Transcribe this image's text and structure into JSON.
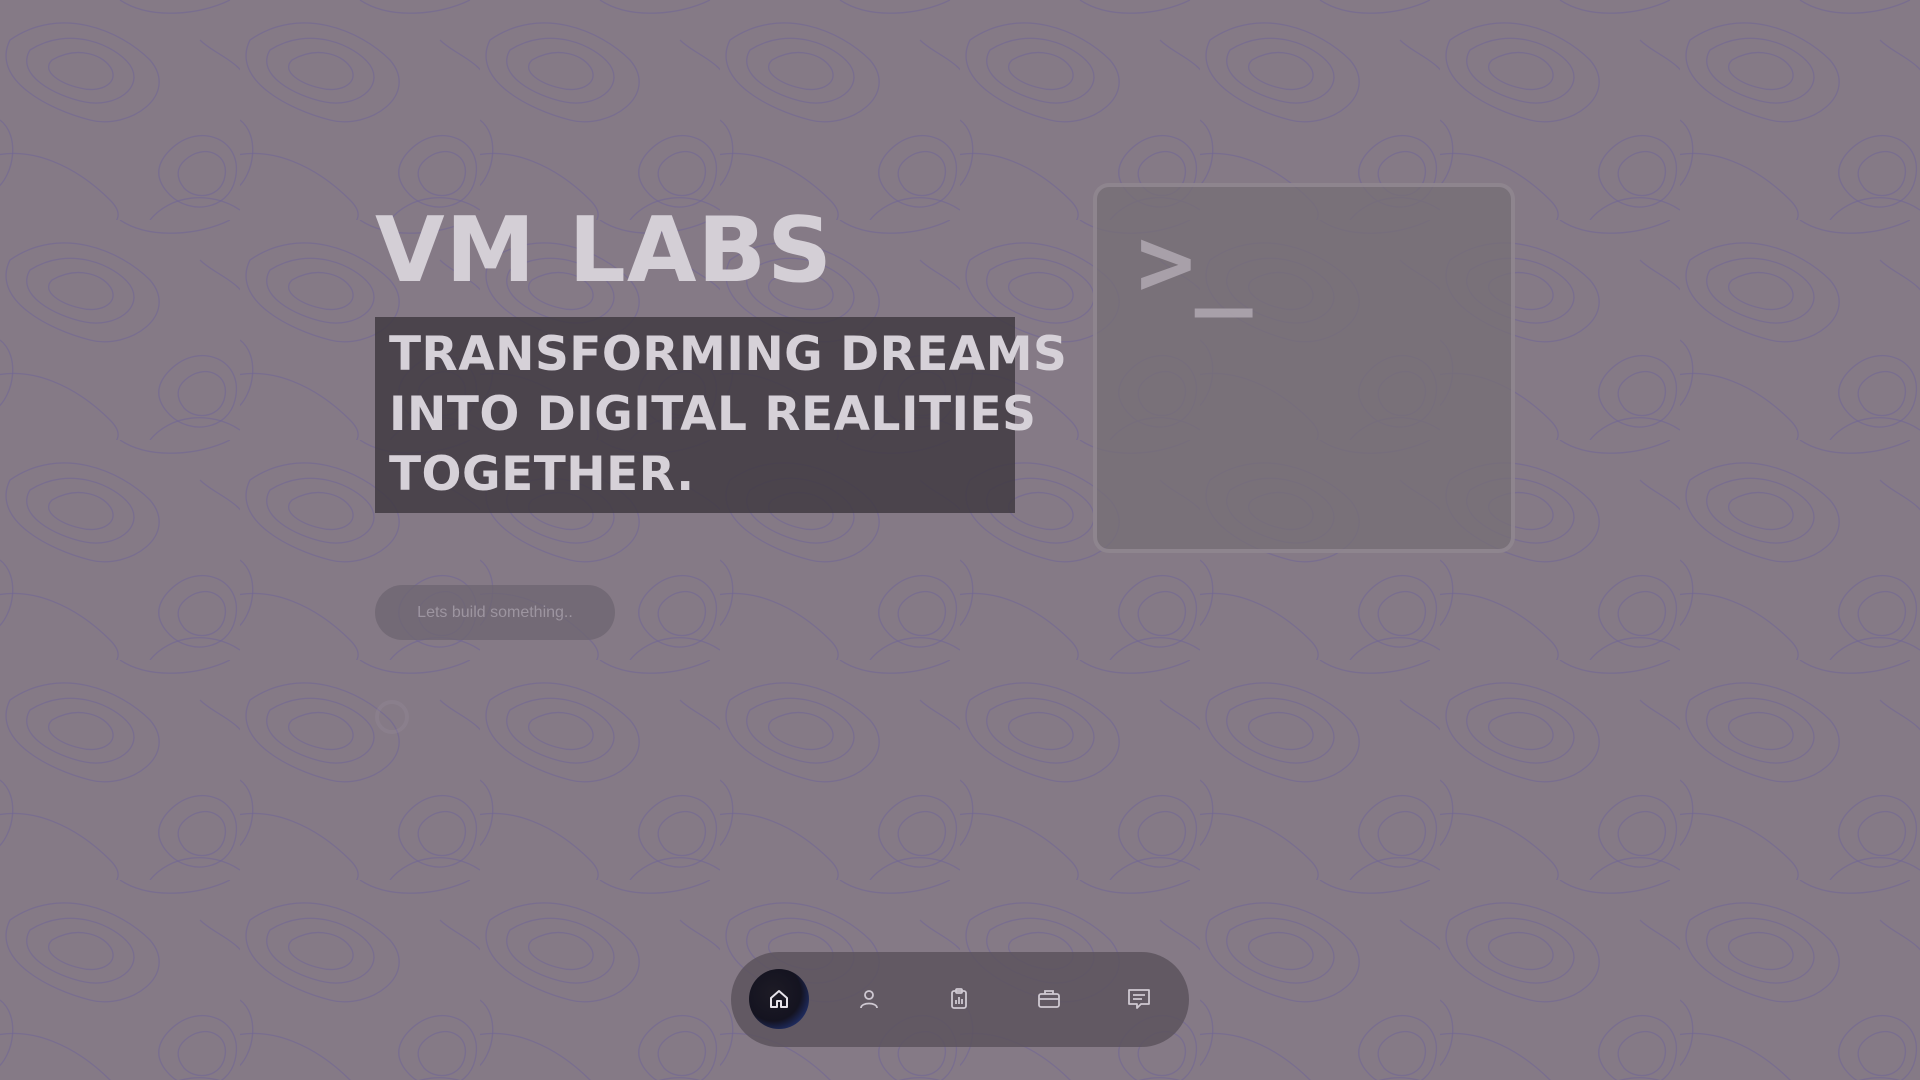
{
  "hero": {
    "title": "VM LABS",
    "tagline_lines": [
      "TRANSFORMING DREAMS",
      "INTO DIGITAL REALITIES",
      "TOGETHER."
    ],
    "cta_label": "Lets build something.."
  },
  "terminal": {
    "prompt": ">_"
  },
  "nav": {
    "items": [
      {
        "name": "home",
        "icon": "home-icon",
        "active": true
      },
      {
        "name": "about",
        "icon": "user-icon",
        "active": false
      },
      {
        "name": "stats",
        "icon": "clipboard-chart-icon",
        "active": false
      },
      {
        "name": "portfolio",
        "icon": "briefcase-icon",
        "active": false
      },
      {
        "name": "contact",
        "icon": "message-icon",
        "active": false
      }
    ]
  },
  "colors": {
    "background": "#857a86",
    "contour_lines": "#6f6495",
    "title_text": "#d4cfd6",
    "tagline_box": "#3e383f",
    "active_nav": "#3158c4"
  }
}
